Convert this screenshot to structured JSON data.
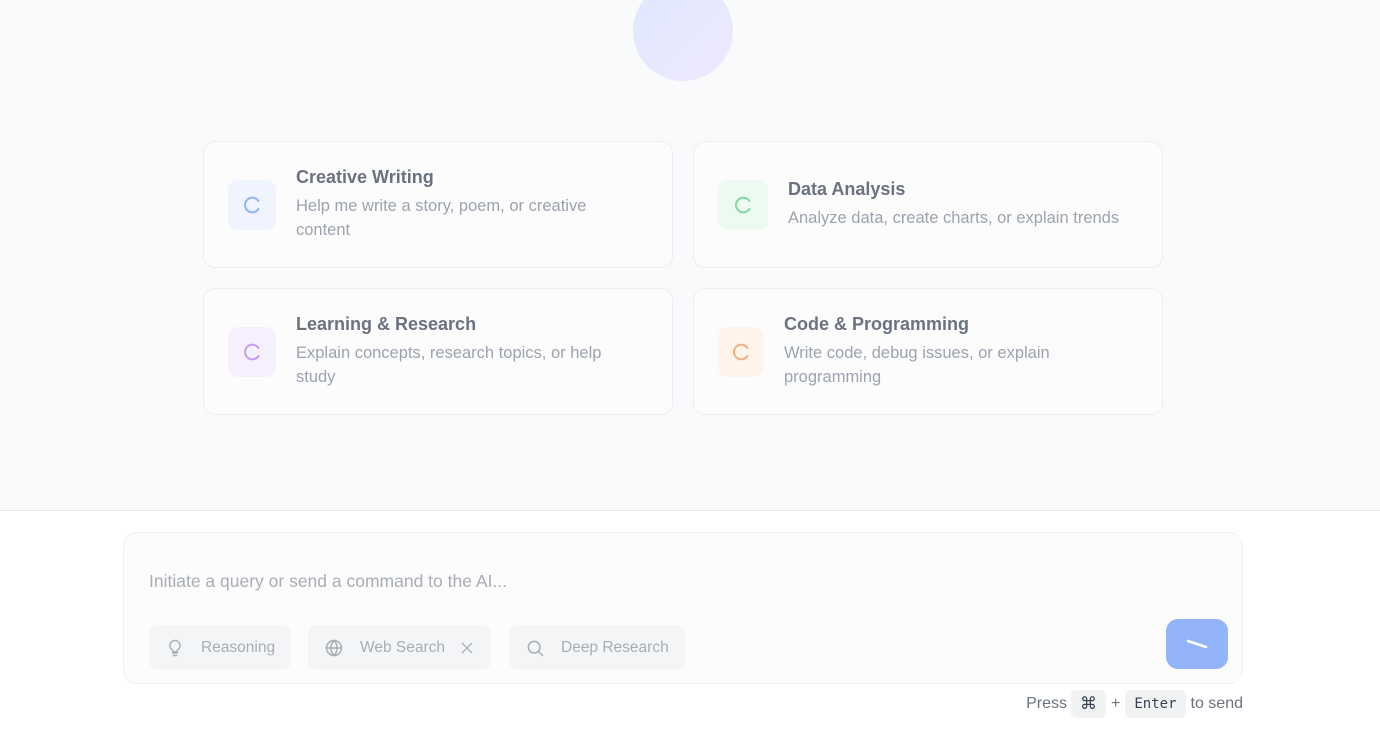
{
  "suggestions": [
    {
      "title": "Creative Writing",
      "description": "Help me write a story, poem, or creative content",
      "icon": "loading-spinner-icon",
      "accent": "#93b4f8",
      "icon_bg": "#eff4fe"
    },
    {
      "title": "Data Analysis",
      "description": "Analyze data, create charts, or explain trends",
      "icon": "loading-spinner-icon",
      "accent": "#86d6a6",
      "icon_bg": "#ecfaf1"
    },
    {
      "title": "Learning & Research",
      "description": "Explain concepts, research topics, or help study",
      "icon": "loading-spinner-icon",
      "accent": "#c99cf6",
      "icon_bg": "#f6f0fe"
    },
    {
      "title": "Code & Programming",
      "description": "Write code, debug issues, or explain programming",
      "icon": "loading-spinner-icon",
      "accent": "#f3ae85",
      "icon_bg": "#fef4ec"
    }
  ],
  "composer": {
    "placeholder": "Initiate a query or send a command to the AI...",
    "value": ""
  },
  "chips": {
    "reasoning": {
      "label": "Reasoning",
      "icon": "lightbulb-icon"
    },
    "web_search": {
      "label": "Web Search",
      "icon": "globe-icon",
      "active": true
    },
    "deep_research": {
      "label": "Deep Research",
      "icon": "search-icon"
    }
  },
  "send_button": {
    "icon": "send-icon",
    "color": "#93b4f8"
  },
  "hint": {
    "press": "Press",
    "key1": "⌘",
    "plus": "+",
    "key2": "Enter",
    "suffix": "to send"
  }
}
